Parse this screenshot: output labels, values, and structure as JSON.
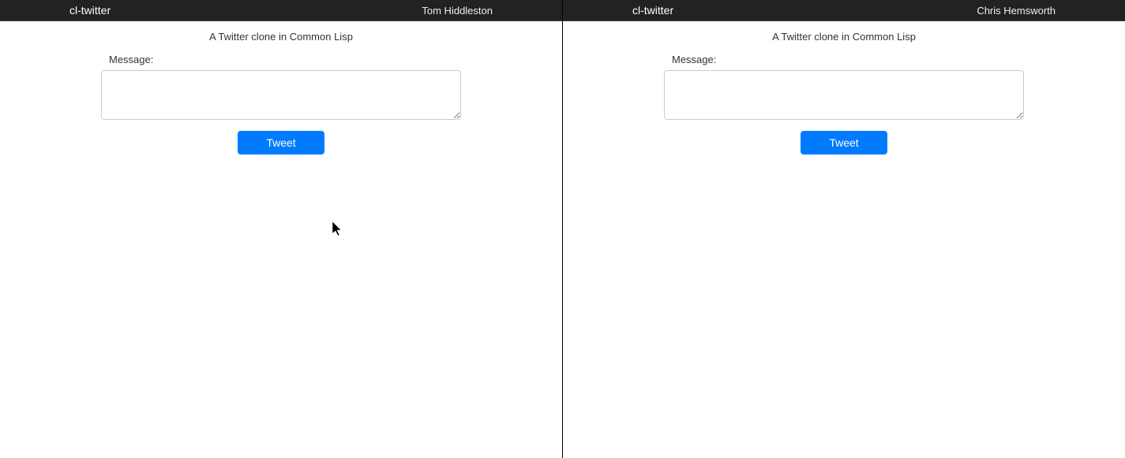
{
  "left": {
    "navbar": {
      "brand": "cl-twitter",
      "username": "Tom Hiddleston"
    },
    "subtitle": "A Twitter clone in Common Lisp",
    "form": {
      "label": "Message:",
      "textarea_value": "",
      "submit_label": "Tweet"
    }
  },
  "right": {
    "navbar": {
      "brand": "cl-twitter",
      "username": "Chris Hemsworth"
    },
    "subtitle": "A Twitter clone in Common Lisp",
    "form": {
      "label": "Message:",
      "textarea_value": "",
      "submit_label": "Tweet"
    }
  },
  "colors": {
    "navbar_bg": "#222222",
    "button_bg": "#007bff",
    "button_text": "#ffffff"
  }
}
